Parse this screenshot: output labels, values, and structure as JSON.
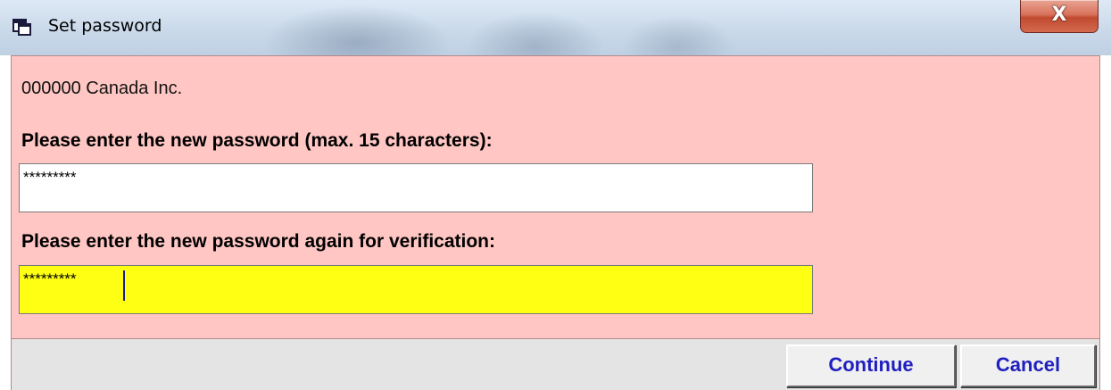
{
  "window": {
    "title": "Set password",
    "close_symbol": "X",
    "icon": "app-window-icon"
  },
  "dialog": {
    "company": "000000 Canada Inc.",
    "password_label": "Please enter the new password (max. 15 characters):",
    "password_value": "*********",
    "verify_label": "Please enter the new password again for verification:",
    "verify_value": "*********"
  },
  "buttons": {
    "continue": "Continue",
    "cancel": "Cancel"
  },
  "colors": {
    "client_background": "#ffc6c3",
    "active_field": "#ffff14",
    "button_text": "#1f1fbf",
    "close_button": "#c14a30"
  }
}
